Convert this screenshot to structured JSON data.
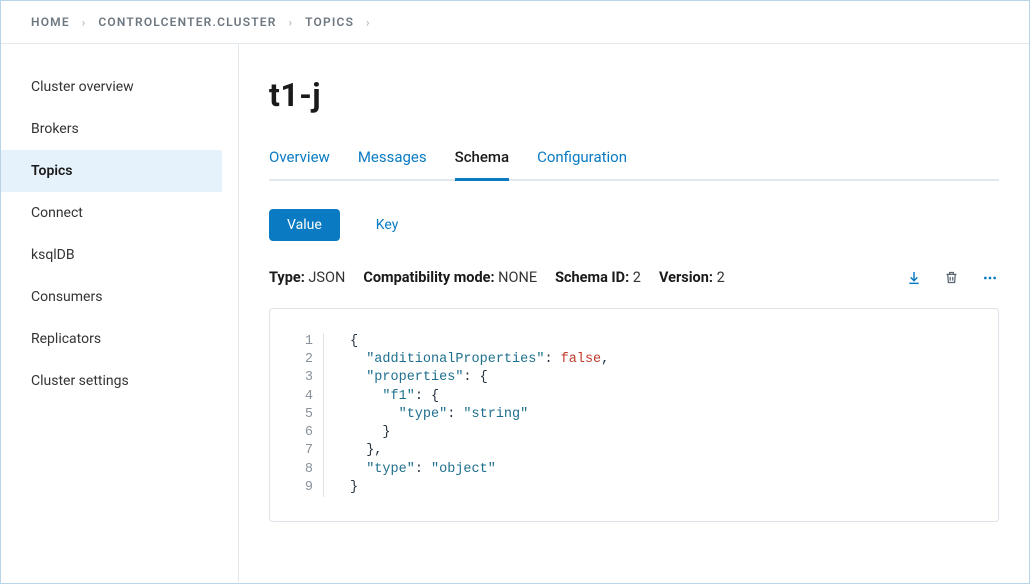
{
  "breadcrumb": [
    "HOME",
    "CONTROLCENTER.CLUSTER",
    "TOPICS"
  ],
  "sidebar": {
    "items": [
      {
        "label": "Cluster overview"
      },
      {
        "label": "Brokers"
      },
      {
        "label": "Topics"
      },
      {
        "label": "Connect"
      },
      {
        "label": "ksqlDB"
      },
      {
        "label": "Consumers"
      },
      {
        "label": "Replicators"
      },
      {
        "label": "Cluster settings"
      }
    ],
    "activeIndex": 2
  },
  "page": {
    "title": "t1-j"
  },
  "tabs": {
    "items": [
      "Overview",
      "Messages",
      "Schema",
      "Configuration"
    ],
    "activeIndex": 2
  },
  "subtabs": {
    "items": [
      "Value",
      "Key"
    ],
    "activeIndex": 0
  },
  "meta": {
    "type_label": "Type:",
    "type_value": "JSON",
    "compat_label": "Compatibility mode:",
    "compat_value": "NONE",
    "schema_id_label": "Schema ID:",
    "schema_id_value": "2",
    "version_label": "Version:",
    "version_value": "2"
  },
  "schema_code": {
    "lines": [
      [
        {
          "t": "punc",
          "v": "{"
        }
      ],
      [
        {
          "t": "indent",
          "v": "  "
        },
        {
          "t": "key",
          "v": "\"additionalProperties\""
        },
        {
          "t": "punc",
          "v": ": "
        },
        {
          "t": "false",
          "v": "false"
        },
        {
          "t": "punc",
          "v": ","
        }
      ],
      [
        {
          "t": "indent",
          "v": "  "
        },
        {
          "t": "key",
          "v": "\"properties\""
        },
        {
          "t": "punc",
          "v": ": {"
        }
      ],
      [
        {
          "t": "indent",
          "v": "    "
        },
        {
          "t": "key",
          "v": "\"f1\""
        },
        {
          "t": "punc",
          "v": ": {"
        }
      ],
      [
        {
          "t": "indent",
          "v": "      "
        },
        {
          "t": "key",
          "v": "\"type\""
        },
        {
          "t": "punc",
          "v": ": "
        },
        {
          "t": "str",
          "v": "\"string\""
        }
      ],
      [
        {
          "t": "indent",
          "v": "    "
        },
        {
          "t": "punc",
          "v": "}"
        }
      ],
      [
        {
          "t": "indent",
          "v": "  "
        },
        {
          "t": "punc",
          "v": "},"
        }
      ],
      [
        {
          "t": "indent",
          "v": "  "
        },
        {
          "t": "key",
          "v": "\"type\""
        },
        {
          "t": "punc",
          "v": ": "
        },
        {
          "t": "str",
          "v": "\"object\""
        }
      ],
      [
        {
          "t": "punc",
          "v": "}"
        }
      ]
    ]
  }
}
